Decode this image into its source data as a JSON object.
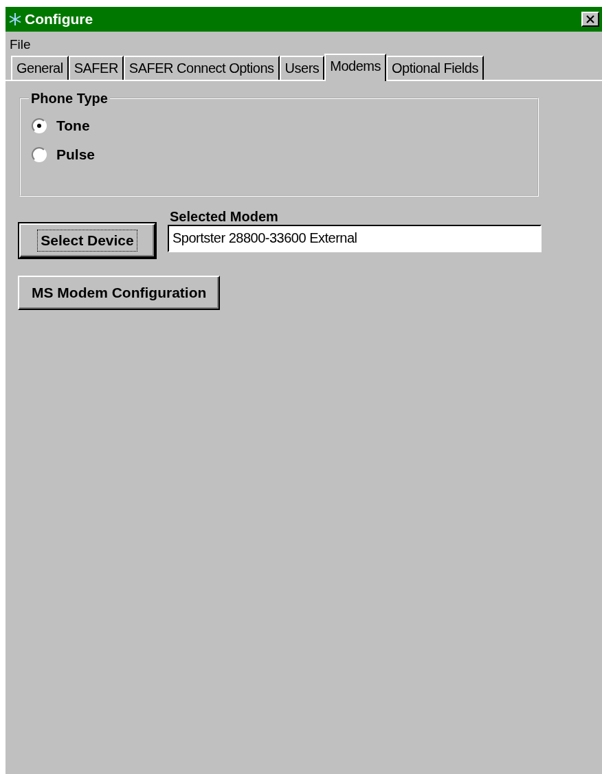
{
  "window": {
    "title": "Configure"
  },
  "menu": [
    {
      "label": "File"
    }
  ],
  "tabs": [
    {
      "label": "General",
      "selected": false
    },
    {
      "label": "SAFER",
      "selected": false
    },
    {
      "label": "SAFER Connect Options",
      "selected": false
    },
    {
      "label": "Users",
      "selected": false
    },
    {
      "label": "Modems",
      "selected": true
    },
    {
      "label": "Optional Fields",
      "selected": false
    }
  ],
  "phone_type": {
    "title": "Phone Type",
    "options": [
      {
        "label": "Tone",
        "selected": true
      },
      {
        "label": "Pulse",
        "selected": false
      }
    ]
  },
  "select_device_button": "Select Device",
  "selected_modem": {
    "label": "Selected Modem",
    "value": "Sportster 28800-33600 External"
  },
  "ms_modem_button": "MS Modem Configuration"
}
